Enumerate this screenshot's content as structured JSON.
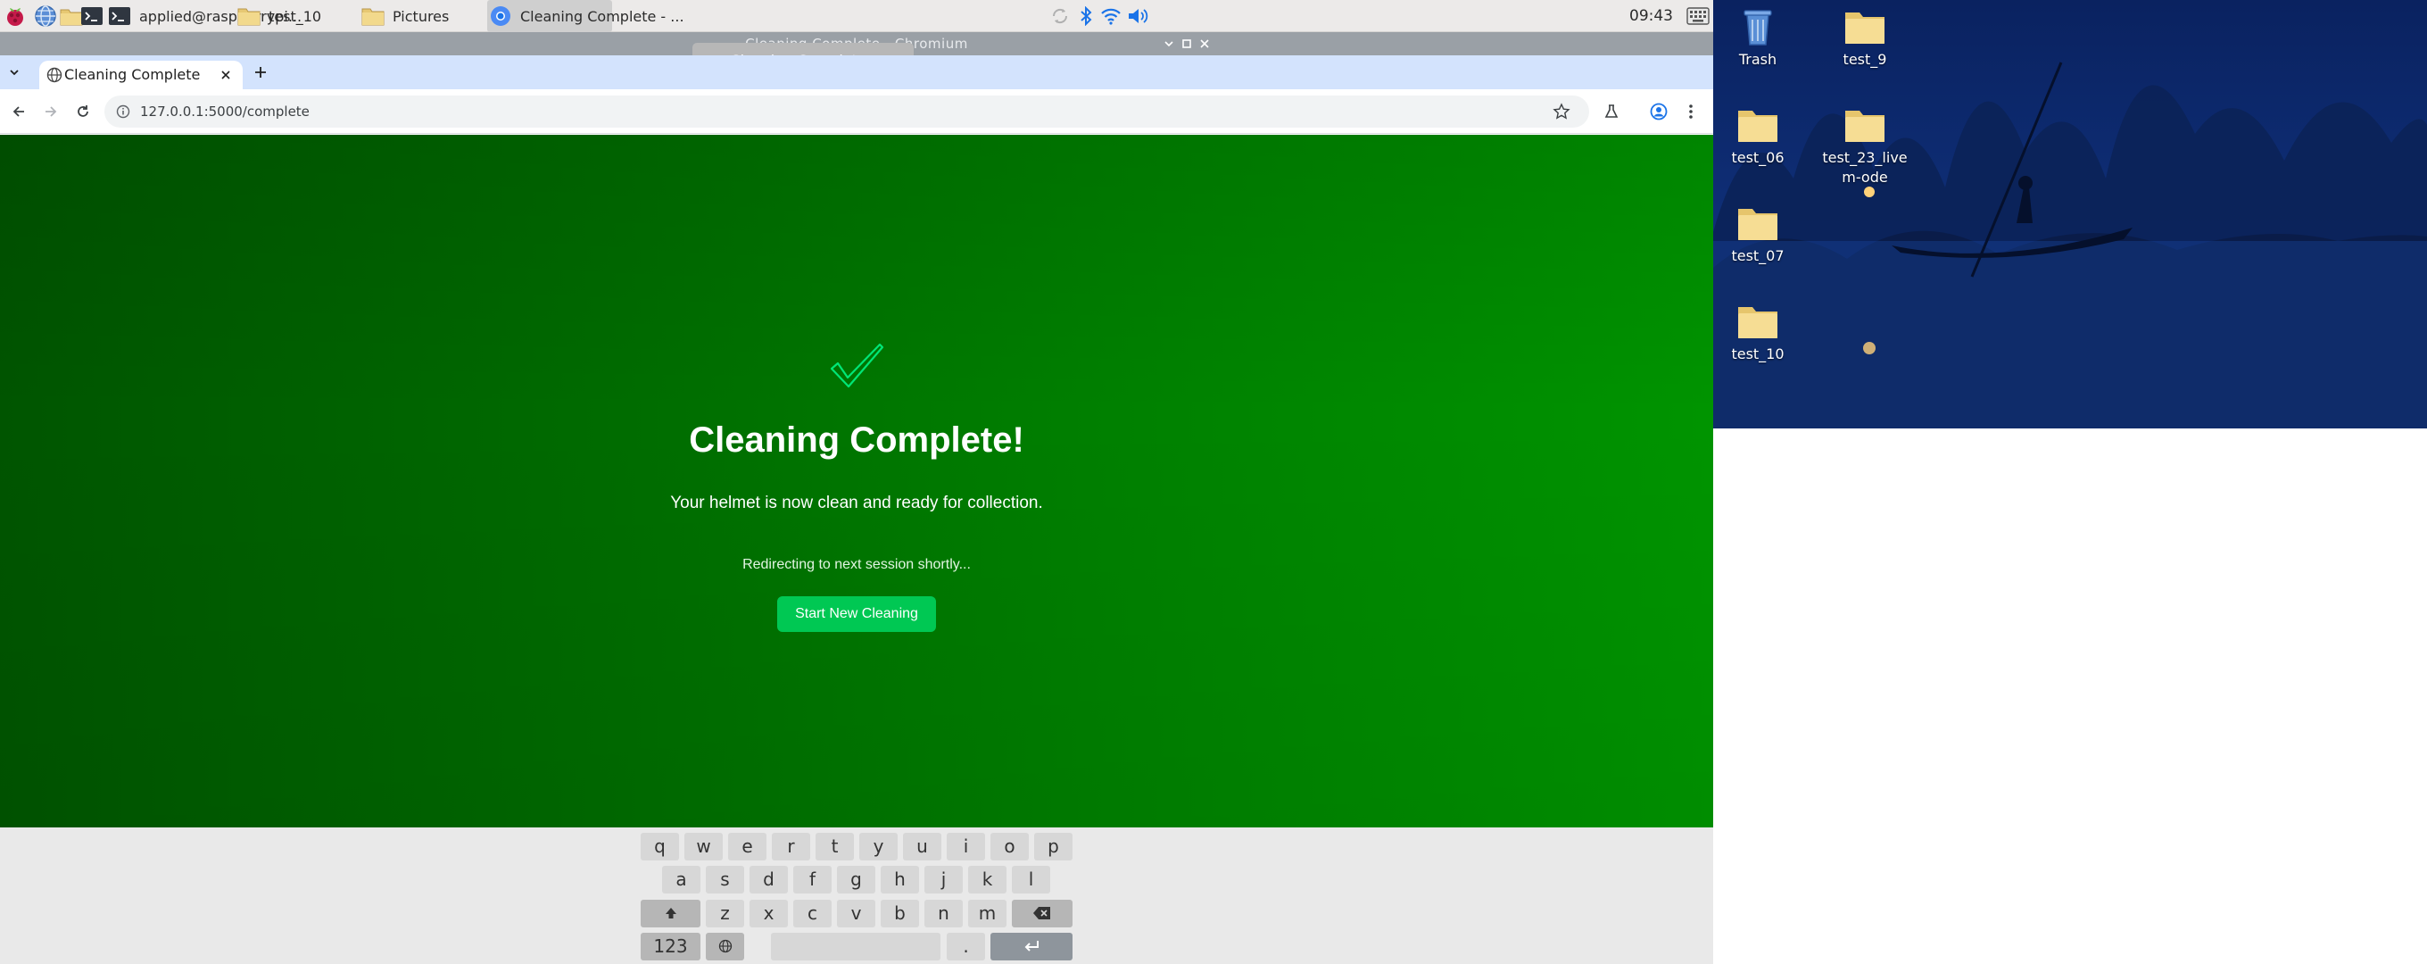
{
  "taskbar": {
    "tasks": [
      {
        "label": "applied@raspberrypi..."
      },
      {
        "label": "test_10"
      },
      {
        "label": "Pictures"
      },
      {
        "label": "Cleaning Complete - ..."
      }
    ],
    "clock": "09:43"
  },
  "window": {
    "title": "Cleaning Complete - Chromium",
    "tooltip": "Cleaning Complete - Chromium"
  },
  "browser": {
    "tab_title": "Cleaning Complete",
    "url": "127.0.0.1:5000/complete"
  },
  "page": {
    "check_glyph": "✓",
    "heading": "Cleaning Complete!",
    "message": "Your helmet is now clean and ready for collection.",
    "redirect_text": "Redirecting to next session shortly...",
    "button_label": "Start New Cleaning",
    "colors": {
      "accent": "#00c853",
      "background_start": "#005500",
      "background_end": "#009400",
      "check": "#00e676"
    }
  },
  "keyboard": {
    "row1": [
      "q",
      "w",
      "e",
      "r",
      "t",
      "y",
      "u",
      "i",
      "o",
      "p"
    ],
    "row2": [
      "a",
      "s",
      "d",
      "f",
      "g",
      "h",
      "j",
      "k",
      "l"
    ],
    "row3": [
      "z",
      "x",
      "c",
      "v",
      "b",
      "n",
      "m"
    ],
    "numbers_label": "123",
    "period": "."
  },
  "desktop": {
    "icons": [
      {
        "label": "Trash"
      },
      {
        "label": "test_9"
      },
      {
        "label": "test_06"
      },
      {
        "label": "test_23_livem-ode"
      },
      {
        "label": "test_07"
      },
      {
        "label": "test_10"
      }
    ]
  }
}
